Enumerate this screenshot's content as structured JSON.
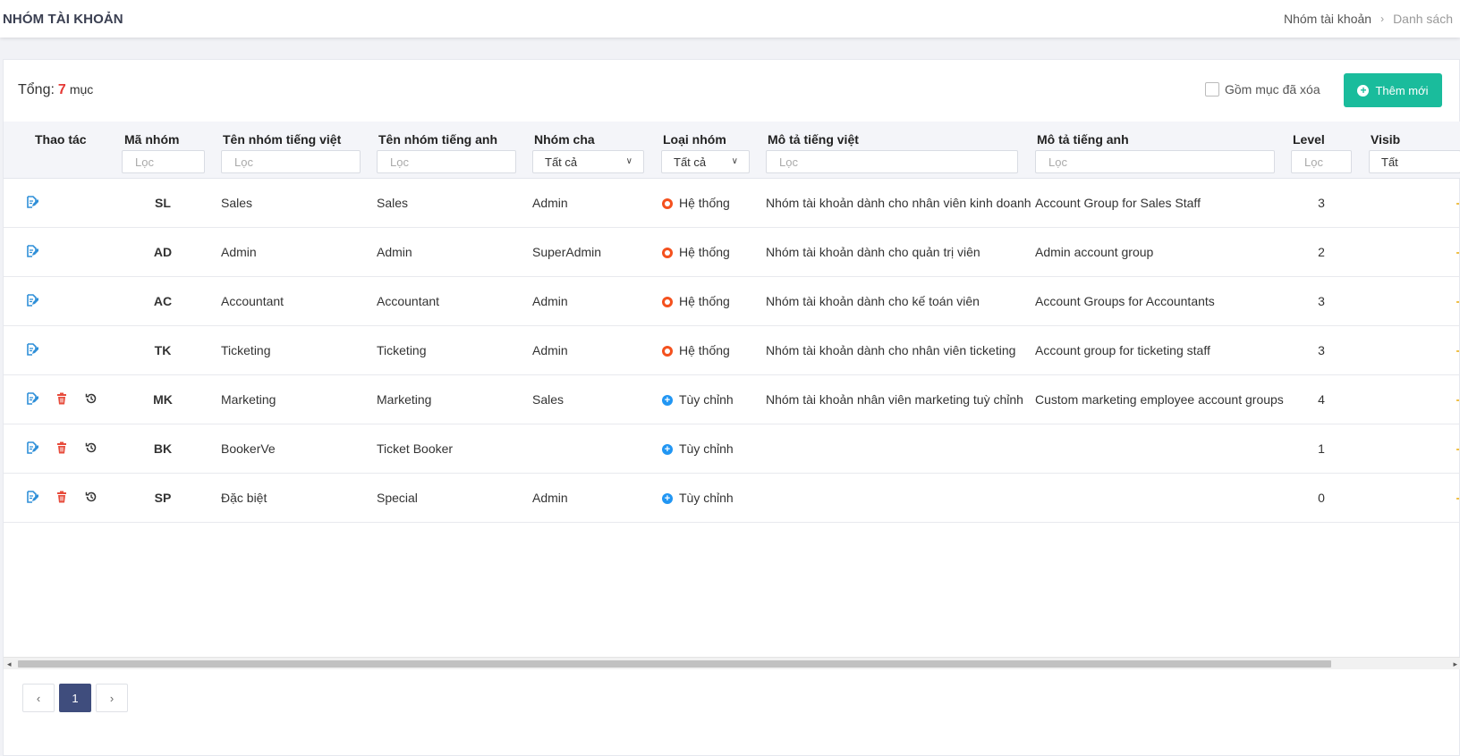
{
  "header": {
    "title": "NHÓM TÀI KHOẢN",
    "breadcrumb": [
      "Nhóm tài khoản",
      "Danh sách"
    ]
  },
  "toolbar": {
    "total_label": "Tổng:",
    "total_count": "7",
    "total_unit": "mục",
    "include_deleted_label": "Gồm mục đã xóa",
    "include_deleted_checked": false,
    "add_button_label": "Thêm mới"
  },
  "table": {
    "columns": {
      "actions": "Thao tác",
      "code": "Mã nhóm",
      "name_vi": "Tên nhóm tiếng việt",
      "name_en": "Tên nhóm tiếng anh",
      "parent": "Nhóm cha",
      "type": "Loại nhóm",
      "desc_vi": "Mô tả tiếng việt",
      "desc_en": "Mô tả tiếng anh",
      "level": "Level",
      "visible": "Visib"
    },
    "filter_placeholder": "Lọc",
    "parent_filter_value": "Tất cả",
    "type_filter_value": "Tất cả",
    "visible_filter_value": "Tất",
    "rows": [
      {
        "code": "SL",
        "name_vi": "Sales",
        "name_en": "Sales",
        "parent": "Admin",
        "type": "Hệ thống",
        "type_kind": "system",
        "desc_vi": "Nhóm tài khoản dành cho nhân viên kinh doanh",
        "desc_en": "Account Group for Sales Staff",
        "level": "3",
        "can_delete": false
      },
      {
        "code": "AD",
        "name_vi": "Admin",
        "name_en": "Admin",
        "parent": "SuperAdmin",
        "type": "Hệ thống",
        "type_kind": "system",
        "desc_vi": "Nhóm tài khoản dành cho quản trị viên",
        "desc_en": "Admin account group",
        "level": "2",
        "can_delete": false
      },
      {
        "code": "AC",
        "name_vi": "Accountant",
        "name_en": "Accountant",
        "parent": "Admin",
        "type": "Hệ thống",
        "type_kind": "system",
        "desc_vi": "Nhóm tài khoản dành cho kế toán viên",
        "desc_en": "Account Groups for Accountants",
        "level": "3",
        "can_delete": false
      },
      {
        "code": "TK",
        "name_vi": "Ticketing",
        "name_en": "Ticketing",
        "parent": "Admin",
        "type": "Hệ thống",
        "type_kind": "system",
        "desc_vi": "Nhóm tài khoản dành cho nhân viên ticketing",
        "desc_en": "Account group for ticketing staff",
        "level": "3",
        "can_delete": false
      },
      {
        "code": "MK",
        "name_vi": "Marketing",
        "name_en": "Marketing",
        "parent": "Sales",
        "type": "Tùy chỉnh",
        "type_kind": "custom",
        "desc_vi": "Nhóm tài khoản nhân viên marketing tuỳ chỉnh",
        "desc_en": "Custom marketing employee account groups",
        "level": "4",
        "can_delete": true
      },
      {
        "code": "BK",
        "name_vi": "BookerVe",
        "name_en": "Ticket Booker",
        "parent": "",
        "type": "Tùy chỉnh",
        "type_kind": "custom",
        "desc_vi": "",
        "desc_en": "",
        "level": "1",
        "can_delete": true
      },
      {
        "code": "SP",
        "name_vi": "Đặc biệt",
        "name_en": "Special",
        "parent": "Admin",
        "type": "Tùy chỉnh",
        "type_kind": "custom",
        "desc_vi": "",
        "desc_en": "",
        "level": "0",
        "can_delete": true
      }
    ]
  },
  "pagination": {
    "prev": "‹",
    "current": "1",
    "next": "›"
  },
  "colors": {
    "accent": "#1abc9c",
    "total_count": "#e53935",
    "system_type": "#f4511e",
    "custom_type": "#2196f3",
    "edit_icon": "#2f8fd8",
    "delete_icon": "#e74c3c",
    "page_active": "#3f4d7d"
  },
  "icons": {
    "edit": "edit-icon",
    "delete": "trash-icon",
    "history": "history-icon",
    "system": "gear-icon",
    "custom": "plus-circle-icon"
  }
}
